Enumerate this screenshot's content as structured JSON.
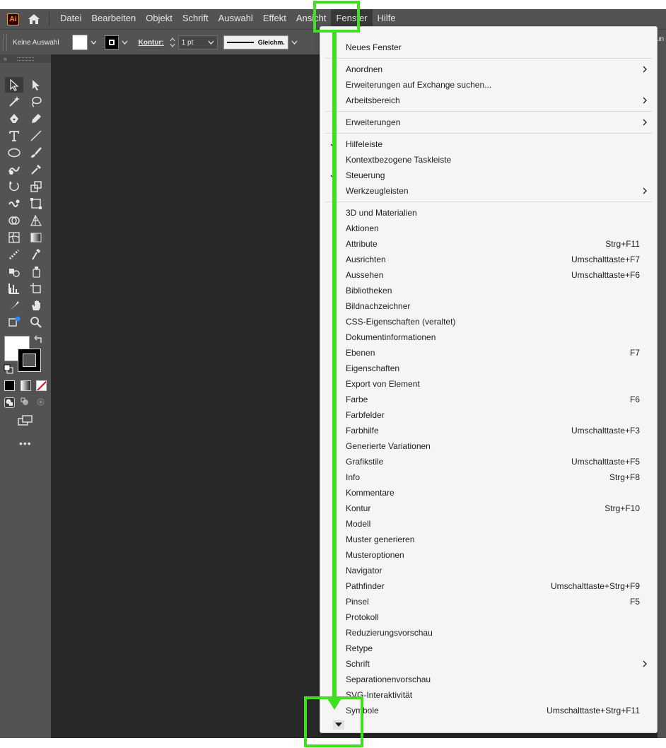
{
  "app": {
    "logo_text": "Ai"
  },
  "menubar": {
    "items": [
      "Datei",
      "Bearbeiten",
      "Objekt",
      "Schrift",
      "Auswahl",
      "Effekt",
      "Ansicht",
      "Fenster",
      "Hilfe"
    ],
    "active": "Fenster"
  },
  "controlbar": {
    "selection_label": "Keine Auswahl",
    "stroke_label": "Kontur:",
    "stroke_weight": "1 pt",
    "stroke_profile": "Gleichm.",
    "right_cut_text": "un"
  },
  "toolbar": {
    "more_label": "•••"
  },
  "fenster_menu": {
    "sections": [
      [
        {
          "label": "Neues Fenster"
        }
      ],
      [
        {
          "label": "Anordnen",
          "submenu": true
        },
        {
          "label": "Erweiterungen auf Exchange suchen..."
        },
        {
          "label": "Arbeitsbereich",
          "submenu": true
        }
      ],
      [
        {
          "label": "Erweiterungen",
          "submenu": true
        }
      ],
      [
        {
          "label": "Hilfeleiste",
          "checked": true
        },
        {
          "label": "Kontextbezogene Taskleiste"
        },
        {
          "label": "Steuerung",
          "checked": true
        },
        {
          "label": "Werkzeugleisten",
          "submenu": true
        }
      ],
      [
        {
          "label": "3D und Materialien"
        },
        {
          "label": "Aktionen"
        },
        {
          "label": "Attribute",
          "shortcut": "Strg+F11"
        },
        {
          "label": "Ausrichten",
          "shortcut": "Umschalttaste+F7"
        },
        {
          "label": "Aussehen",
          "shortcut": "Umschalttaste+F6"
        },
        {
          "label": "Bibliotheken"
        },
        {
          "label": "Bildnachzeichner"
        },
        {
          "label": "CSS-Eigenschaften (veraltet)"
        },
        {
          "label": "Dokumentinformationen"
        },
        {
          "label": "Ebenen",
          "shortcut": "F7"
        },
        {
          "label": "Eigenschaften"
        },
        {
          "label": "Export von Element"
        },
        {
          "label": "Farbe",
          "shortcut": "F6"
        },
        {
          "label": "Farbfelder"
        },
        {
          "label": "Farbhilfe",
          "shortcut": "Umschalttaste+F3"
        },
        {
          "label": "Generierte Variationen"
        },
        {
          "label": "Grafikstile",
          "shortcut": "Umschalttaste+F5"
        },
        {
          "label": "Info",
          "shortcut": "Strg+F8"
        },
        {
          "label": "Kommentare"
        },
        {
          "label": "Kontur",
          "shortcut": "Strg+F10"
        },
        {
          "label": "Modell"
        },
        {
          "label": "Muster generieren"
        },
        {
          "label": "Musteroptionen"
        },
        {
          "label": "Navigator"
        },
        {
          "label": "Pathfinder",
          "shortcut": "Umschalttaste+Strg+F9"
        },
        {
          "label": "Pinsel",
          "shortcut": "F5"
        },
        {
          "label": "Protokoll"
        },
        {
          "label": "Reduzierungsvorschau"
        },
        {
          "label": "Retype"
        },
        {
          "label": "Schrift",
          "submenu": true
        },
        {
          "label": "Separationenvorschau"
        },
        {
          "label": "SVG-Interaktivität"
        },
        {
          "label": "Symbole",
          "shortcut": "Umschalttaste+Strg+F11"
        }
      ]
    ]
  },
  "colors": {
    "ui_bg": "#535353",
    "canvas": "#282828",
    "menu_bg": "#f5f5f5",
    "annotation": "#3ee01f"
  }
}
